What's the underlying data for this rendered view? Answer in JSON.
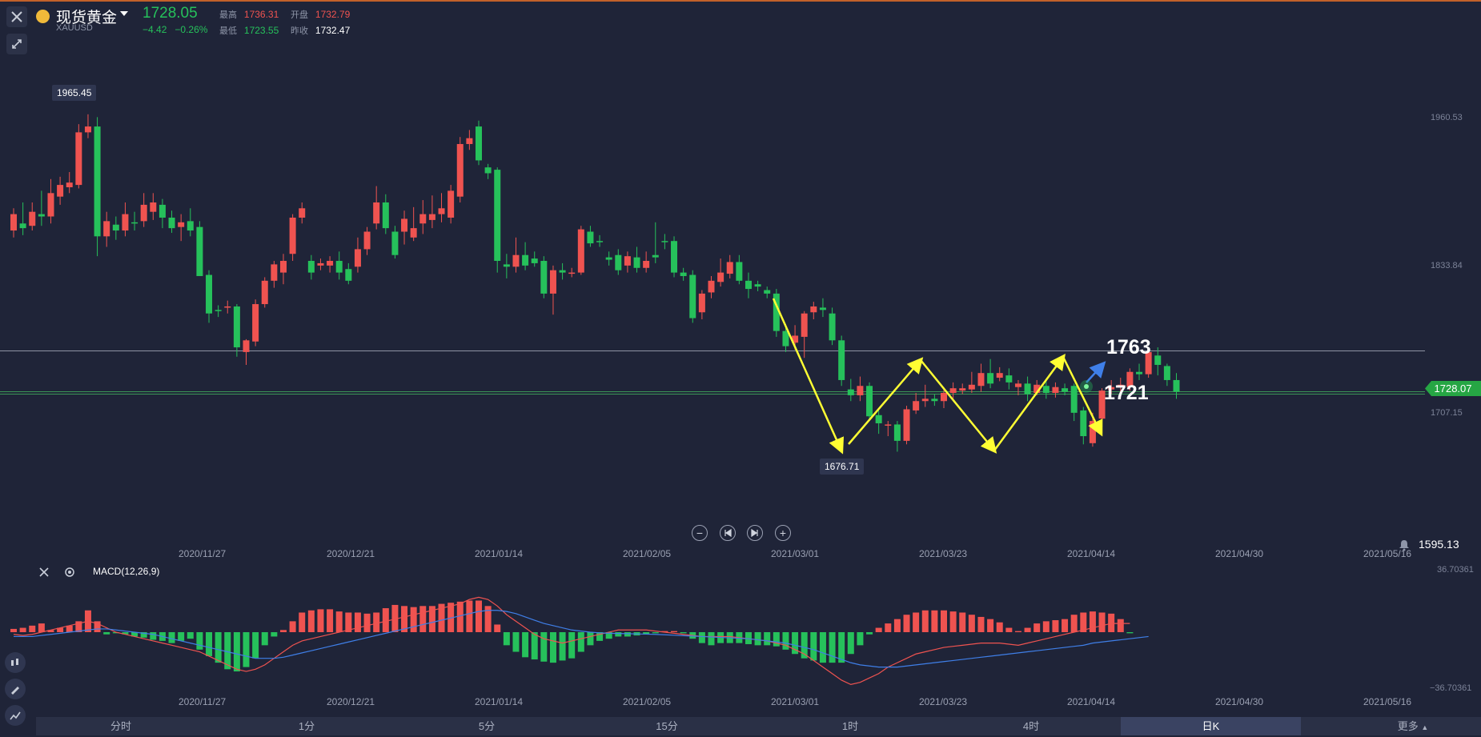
{
  "header": {
    "name": "现货黄金",
    "code": "XAUUSD",
    "price": "1728.05",
    "change": "−4.42",
    "change_pct": "−0.26%",
    "stats": {
      "high_label": "最高",
      "high": "1736.31",
      "open_label": "开盘",
      "open": "1732.79",
      "low_label": "最低",
      "low": "1723.55",
      "prev_label": "昨收",
      "prev": "1732.47"
    }
  },
  "price_axis": {
    "labels": [
      "1960.53",
      "1833.84",
      "1707.15"
    ],
    "current_price": "1728.07",
    "bottom_value": "1595.13"
  },
  "markers": {
    "high": "1965.45",
    "low": "1676.71"
  },
  "annotations": {
    "resistance": "1763",
    "support": "1721"
  },
  "date_axis": [
    "2020/11/27",
    "2020/12/21",
    "2021/01/14",
    "2021/02/05",
    "2021/03/01",
    "2021/03/23",
    "2021/04/14",
    "2021/04/30",
    "2021/05/16"
  ],
  "macd": {
    "label": "MACD(12,26,9)",
    "top": "36.70361",
    "bottom": "−36.70361"
  },
  "bottom_bar": {
    "items": [
      "分时",
      "1分",
      "5分",
      "15分",
      "1时",
      "4时",
      "日K",
      "更多"
    ],
    "active": "日K"
  },
  "icons": [
    "close-icon",
    "gold-coin-icon",
    "caret-down-icon",
    "expand-icon",
    "zoom-out-icon",
    "step-back-icon",
    "step-forward-icon",
    "zoom-in-icon",
    "bell-icon",
    "settings-icon",
    "candle-tool-icon",
    "draw-tool-icon",
    "indicator-tool-icon"
  ],
  "colors": {
    "background": "#1f2438",
    "up": "#ef5350",
    "down": "#26c15b",
    "annotation_arrow": "#ffff33",
    "macd_dif": "#ef5350",
    "macd_dea": "#3f7fe8"
  },
  "chart_data": {
    "type": "candlestick",
    "price_range": [
      1595.13,
      2000
    ],
    "horizontal_lines": [
      1763,
      1728.07,
      1726
    ],
    "candles": [
      {
        "o": 1866,
        "c": 1880,
        "h": 1885,
        "l": 1860
      },
      {
        "o": 1872,
        "c": 1868,
        "h": 1890,
        "l": 1862
      },
      {
        "o": 1870,
        "c": 1882,
        "h": 1890,
        "l": 1866
      },
      {
        "o": 1880,
        "c": 1878,
        "h": 1900,
        "l": 1870
      },
      {
        "o": 1878,
        "c": 1898,
        "h": 1910,
        "l": 1872
      },
      {
        "o": 1895,
        "c": 1905,
        "h": 1912,
        "l": 1888
      },
      {
        "o": 1903,
        "c": 1907,
        "h": 1916,
        "l": 1898
      },
      {
        "o": 1905,
        "c": 1950,
        "h": 1957,
        "l": 1902
      },
      {
        "o": 1950,
        "c": 1955,
        "h": 1965.45,
        "l": 1945
      },
      {
        "o": 1955,
        "c": 1861,
        "h": 1963,
        "l": 1844
      },
      {
        "o": 1861,
        "c": 1874,
        "h": 1882,
        "l": 1852
      },
      {
        "o": 1871,
        "c": 1866,
        "h": 1878,
        "l": 1858
      },
      {
        "o": 1866,
        "c": 1880,
        "h": 1890,
        "l": 1861
      },
      {
        "o": 1873,
        "c": 1872,
        "h": 1882,
        "l": 1866
      },
      {
        "o": 1874,
        "c": 1888,
        "h": 1898,
        "l": 1869
      },
      {
        "o": 1882,
        "c": 1890,
        "h": 1898,
        "l": 1875
      },
      {
        "o": 1888,
        "c": 1877,
        "h": 1893,
        "l": 1868
      },
      {
        "o": 1877,
        "c": 1868,
        "h": 1883,
        "l": 1864
      },
      {
        "o": 1869,
        "c": 1873,
        "h": 1880,
        "l": 1857
      },
      {
        "o": 1874,
        "c": 1866,
        "h": 1885,
        "l": 1861
      },
      {
        "o": 1869,
        "c": 1827,
        "h": 1874,
        "l": 1827
      },
      {
        "o": 1828,
        "c": 1795,
        "h": 1832,
        "l": 1787
      },
      {
        "o": 1798,
        "c": 1797,
        "h": 1802,
        "l": 1792
      },
      {
        "o": 1800,
        "c": 1801,
        "h": 1806,
        "l": 1795
      },
      {
        "o": 1801,
        "c": 1766,
        "h": 1803,
        "l": 1758
      },
      {
        "o": 1762,
        "c": 1772,
        "h": 1773,
        "l": 1751
      },
      {
        "o": 1771,
        "c": 1803,
        "h": 1807,
        "l": 1767
      },
      {
        "o": 1803,
        "c": 1823,
        "h": 1826,
        "l": 1800
      },
      {
        "o": 1823,
        "c": 1837,
        "h": 1840,
        "l": 1817
      },
      {
        "o": 1830,
        "c": 1840,
        "h": 1846,
        "l": 1820
      },
      {
        "o": 1846,
        "c": 1877,
        "h": 1880,
        "l": 1840
      },
      {
        "o": 1877,
        "c": 1885,
        "h": 1890,
        "l": 1872
      },
      {
        "o": 1840,
        "c": 1830,
        "h": 1845,
        "l": 1824
      },
      {
        "o": 1836,
        "c": 1838,
        "h": 1842,
        "l": 1832
      },
      {
        "o": 1836,
        "c": 1840,
        "h": 1844,
        "l": 1830
      },
      {
        "o": 1840,
        "c": 1830,
        "h": 1848,
        "l": 1824
      },
      {
        "o": 1833,
        "c": 1823,
        "h": 1838,
        "l": 1820
      },
      {
        "o": 1835,
        "c": 1850,
        "h": 1860,
        "l": 1830
      },
      {
        "o": 1850,
        "c": 1865,
        "h": 1869,
        "l": 1845
      },
      {
        "o": 1872,
        "c": 1890,
        "h": 1904,
        "l": 1867
      },
      {
        "o": 1890,
        "c": 1868,
        "h": 1897,
        "l": 1863
      },
      {
        "o": 1865,
        "c": 1845,
        "h": 1870,
        "l": 1842
      },
      {
        "o": 1865,
        "c": 1876,
        "h": 1883,
        "l": 1854
      },
      {
        "o": 1860,
        "c": 1868,
        "h": 1886,
        "l": 1857
      },
      {
        "o": 1872,
        "c": 1880,
        "h": 1892,
        "l": 1863
      },
      {
        "o": 1875,
        "c": 1880,
        "h": 1896,
        "l": 1868
      },
      {
        "o": 1880,
        "c": 1885,
        "h": 1898,
        "l": 1873
      },
      {
        "o": 1877,
        "c": 1900,
        "h": 1905,
        "l": 1872
      },
      {
        "o": 1895,
        "c": 1940,
        "h": 1946,
        "l": 1890
      },
      {
        "o": 1940,
        "c": 1945,
        "h": 1952,
        "l": 1935
      },
      {
        "o": 1955,
        "c": 1926,
        "h": 1960,
        "l": 1922
      },
      {
        "o": 1920,
        "c": 1915,
        "h": 1923,
        "l": 1910
      },
      {
        "o": 1918,
        "c": 1840,
        "h": 1920,
        "l": 1830
      },
      {
        "o": 1837,
        "c": 1835,
        "h": 1846,
        "l": 1825
      },
      {
        "o": 1835,
        "c": 1845,
        "h": 1860,
        "l": 1830
      },
      {
        "o": 1845,
        "c": 1836,
        "h": 1856,
        "l": 1832
      },
      {
        "o": 1842,
        "c": 1838,
        "h": 1848,
        "l": 1835
      },
      {
        "o": 1840,
        "c": 1812,
        "h": 1844,
        "l": 1808
      },
      {
        "o": 1812,
        "c": 1832,
        "h": 1836,
        "l": 1794
      },
      {
        "o": 1832,
        "c": 1830,
        "h": 1838,
        "l": 1824
      },
      {
        "o": 1830,
        "c": 1830,
        "h": 1834,
        "l": 1826
      },
      {
        "o": 1830,
        "c": 1867,
        "h": 1870,
        "l": 1828
      },
      {
        "o": 1865,
        "c": 1855,
        "h": 1870,
        "l": 1852
      },
      {
        "o": 1857,
        "c": 1856,
        "h": 1862,
        "l": 1852
      },
      {
        "o": 1843,
        "c": 1841,
        "h": 1848,
        "l": 1836
      },
      {
        "o": 1845,
        "c": 1832,
        "h": 1850,
        "l": 1828
      },
      {
        "o": 1836,
        "c": 1844,
        "h": 1848,
        "l": 1830
      },
      {
        "o": 1843,
        "c": 1834,
        "h": 1852,
        "l": 1830
      },
      {
        "o": 1834,
        "c": 1840,
        "h": 1848,
        "l": 1830
      },
      {
        "o": 1845,
        "c": 1843,
        "h": 1873,
        "l": 1838
      },
      {
        "o": 1857,
        "c": 1856,
        "h": 1863,
        "l": 1850
      },
      {
        "o": 1857,
        "c": 1830,
        "h": 1861,
        "l": 1826
      },
      {
        "o": 1830,
        "c": 1827,
        "h": 1834,
        "l": 1823
      },
      {
        "o": 1828,
        "c": 1791,
        "h": 1832,
        "l": 1787
      },
      {
        "o": 1796,
        "c": 1812,
        "h": 1815,
        "l": 1790
      },
      {
        "o": 1813,
        "c": 1823,
        "h": 1827,
        "l": 1808
      },
      {
        "o": 1822,
        "c": 1830,
        "h": 1842,
        "l": 1818
      },
      {
        "o": 1829,
        "c": 1839,
        "h": 1845,
        "l": 1825
      },
      {
        "o": 1839,
        "c": 1823,
        "h": 1845,
        "l": 1820
      },
      {
        "o": 1823,
        "c": 1816,
        "h": 1830,
        "l": 1808
      },
      {
        "o": 1820,
        "c": 1818,
        "h": 1823,
        "l": 1814
      },
      {
        "o": 1815,
        "c": 1812,
        "h": 1818,
        "l": 1808
      },
      {
        "o": 1812,
        "c": 1780,
        "h": 1816,
        "l": 1775
      },
      {
        "o": 1780,
        "c": 1767,
        "h": 1786,
        "l": 1762
      },
      {
        "o": 1770,
        "c": 1776,
        "h": 1785,
        "l": 1764
      },
      {
        "o": 1775,
        "c": 1795,
        "h": 1797,
        "l": 1757
      },
      {
        "o": 1796,
        "c": 1801,
        "h": 1805,
        "l": 1790
      },
      {
        "o": 1800,
        "c": 1798,
        "h": 1808,
        "l": 1792
      },
      {
        "o": 1795,
        "c": 1772,
        "h": 1800,
        "l": 1768
      },
      {
        "o": 1772,
        "c": 1738,
        "h": 1776,
        "l": 1733
      },
      {
        "o": 1730,
        "c": 1725,
        "h": 1739,
        "l": 1720
      },
      {
        "o": 1725,
        "c": 1733,
        "h": 1741,
        "l": 1720
      },
      {
        "o": 1733,
        "c": 1707,
        "h": 1736,
        "l": 1704
      },
      {
        "o": 1708,
        "c": 1701,
        "h": 1712,
        "l": 1692
      },
      {
        "o": 1700,
        "c": 1700,
        "h": 1703,
        "l": 1690
      },
      {
        "o": 1700,
        "c": 1686,
        "h": 1703,
        "l": 1676.71
      },
      {
        "o": 1686,
        "c": 1713,
        "h": 1716,
        "l": 1683
      },
      {
        "o": 1712,
        "c": 1720,
        "h": 1727,
        "l": 1709
      },
      {
        "o": 1720,
        "c": 1722,
        "h": 1734,
        "l": 1715
      },
      {
        "o": 1722,
        "c": 1720,
        "h": 1726,
        "l": 1716
      },
      {
        "o": 1720,
        "c": 1727,
        "h": 1732,
        "l": 1714
      },
      {
        "o": 1727,
        "c": 1731,
        "h": 1736,
        "l": 1722
      },
      {
        "o": 1729,
        "c": 1731,
        "h": 1735,
        "l": 1726
      },
      {
        "o": 1730,
        "c": 1734,
        "h": 1745,
        "l": 1727
      },
      {
        "o": 1733,
        "c": 1744,
        "h": 1752,
        "l": 1728
      },
      {
        "o": 1744,
        "c": 1735,
        "h": 1756,
        "l": 1731
      },
      {
        "o": 1740,
        "c": 1744,
        "h": 1749,
        "l": 1737
      },
      {
        "o": 1742,
        "c": 1736,
        "h": 1748,
        "l": 1730
      },
      {
        "o": 1732,
        "c": 1735,
        "h": 1738,
        "l": 1725
      },
      {
        "o": 1735,
        "c": 1726,
        "h": 1741,
        "l": 1720
      },
      {
        "o": 1727,
        "c": 1734,
        "h": 1738,
        "l": 1725
      },
      {
        "o": 1733,
        "c": 1727,
        "h": 1737,
        "l": 1722
      },
      {
        "o": 1727,
        "c": 1732,
        "h": 1736,
        "l": 1723
      },
      {
        "o": 1731,
        "c": 1728,
        "h": 1735,
        "l": 1725
      },
      {
        "o": 1733,
        "c": 1710,
        "h": 1735,
        "l": 1703
      },
      {
        "o": 1712,
        "c": 1690,
        "h": 1715,
        "l": 1683
      },
      {
        "o": 1684,
        "c": 1703,
        "h": 1710,
        "l": 1681
      },
      {
        "o": 1705,
        "c": 1729,
        "h": 1731,
        "l": 1702
      },
      {
        "o": 1730,
        "c": 1732,
        "h": 1738,
        "l": 1726
      },
      {
        "o": 1732,
        "c": 1734,
        "h": 1740,
        "l": 1728
      },
      {
        "o": 1732,
        "c": 1745,
        "h": 1748,
        "l": 1729
      },
      {
        "o": 1745,
        "c": 1743,
        "h": 1752,
        "l": 1738
      },
      {
        "o": 1743,
        "c": 1762,
        "h": 1764,
        "l": 1740
      },
      {
        "o": 1759,
        "c": 1751,
        "h": 1766,
        "l": 1742
      },
      {
        "o": 1750,
        "c": 1738,
        "h": 1752,
        "l": 1733
      },
      {
        "o": 1738,
        "c": 1728,
        "h": 1744,
        "l": 1722
      }
    ],
    "macd_hist": [
      1.5,
      2,
      3,
      4,
      1,
      2,
      3,
      5,
      10,
      5,
      -1,
      -0.5,
      -1,
      -2,
      -2.5,
      -3.5,
      -4,
      -5,
      -4,
      -3,
      -8,
      -11,
      -14,
      -17,
      -18,
      -16,
      -12,
      -6,
      -2,
      1,
      5,
      9,
      10,
      10.5,
      10.5,
      9.5,
      9,
      9,
      8.5,
      9,
      11,
      12.5,
      12,
      11.5,
      12,
      12,
      13,
      13.5,
      14,
      14.5,
      14.5,
      12,
      3.5,
      -6,
      -9,
      -11.5,
      -12.5,
      -13.5,
      -14,
      -13,
      -12,
      -9,
      -6,
      -4,
      -3,
      -2,
      -2,
      -1.5,
      -1,
      -0.5,
      0.5,
      0.5,
      -0.5,
      -3,
      -5,
      -6,
      -5,
      -5,
      -5,
      -5.5,
      -6,
      -6,
      -6.5,
      -8,
      -10,
      -12,
      -13,
      -14,
      -14,
      -14,
      -10,
      -6,
      -1,
      2,
      4,
      6,
      8,
      9,
      10,
      10,
      10,
      9.5,
      9,
      8,
      7,
      6,
      4.5,
      2,
      0.5,
      2,
      4,
      5,
      5.5,
      6,
      8,
      9,
      9.5,
      9,
      8.5,
      6,
      -0.5
    ],
    "macd_dif": [
      -1,
      -1.5,
      -1,
      0,
      1,
      2,
      3,
      4,
      5,
      4,
      2,
      0,
      -1,
      -2,
      -3,
      -4,
      -5,
      -6,
      -7,
      -8,
      -9,
      -11,
      -13,
      -15,
      -17,
      -18,
      -17,
      -15,
      -12,
      -9,
      -6,
      -4,
      -3,
      -2,
      -1,
      0,
      1,
      2,
      3,
      4,
      5,
      6,
      7,
      8,
      9,
      10,
      11,
      12,
      13,
      15,
      16,
      15,
      12,
      8,
      5,
      2,
      -1,
      -3,
      -4,
      -5,
      -4,
      -3,
      -2,
      -1,
      0,
      1,
      1,
      1,
      1,
      0.5,
      0,
      -0.5,
      -1,
      -1.5,
      -2,
      -2,
      -2,
      -2,
      -2.5,
      -3,
      -3.5,
      -4,
      -5,
      -6,
      -8,
      -10,
      -13,
      -16,
      -19,
      -22,
      -24,
      -23,
      -21,
      -19,
      -16,
      -14,
      -12,
      -10,
      -9,
      -8,
      -7,
      -6.5,
      -6,
      -5.5,
      -5,
      -5,
      -5,
      -5.5,
      -6,
      -5,
      -4,
      -3,
      -2,
      -1,
      0,
      1,
      2,
      3,
      4,
      4,
      4
    ],
    "macd_dea": [
      -2,
      -2,
      -2,
      -1.5,
      -1,
      -0.5,
      0,
      0.5,
      1,
      1.5,
      1.5,
      1,
      0.5,
      0,
      -0.5,
      -1,
      -2,
      -3,
      -4,
      -5,
      -6,
      -7,
      -8,
      -9,
      -10,
      -11,
      -12,
      -12,
      -12,
      -11.5,
      -10.5,
      -9.5,
      -8.5,
      -7.5,
      -6.5,
      -5.5,
      -4.5,
      -3.5,
      -2.5,
      -1.5,
      -0.5,
      0.5,
      1.5,
      2.5,
      3.5,
      4.5,
      5.5,
      6.5,
      7.5,
      8.5,
      9.5,
      10,
      10,
      9.5,
      8.5,
      7,
      5.5,
      4,
      3,
      2,
      1,
      0.5,
      0,
      -0.3,
      -0.5,
      -0.6,
      -0.7,
      -0.8,
      -0.9,
      -1,
      -1.2,
      -1.4,
      -1.6,
      -1.8,
      -2,
      -2.2,
      -2.4,
      -2.6,
      -2.8,
      -3,
      -3.5,
      -4,
      -4.5,
      -5,
      -6,
      -7,
      -8,
      -9.5,
      -11,
      -12.5,
      -14,
      -15,
      -15.5,
      -16,
      -16,
      -16,
      -15.5,
      -15,
      -14.5,
      -14,
      -13.5,
      -13,
      -12.5,
      -12,
      -11.5,
      -11,
      -10.5,
      -10,
      -9.5,
      -9,
      -8.5,
      -8,
      -7.5,
      -7,
      -6.5,
      -6,
      -5,
      -4.5,
      -4,
      -3.5,
      -3,
      -2.5,
      -2
    ],
    "macd_range": [
      -36.70361,
      36.70361
    ],
    "annotations": [
      "1763",
      "1721"
    ]
  }
}
